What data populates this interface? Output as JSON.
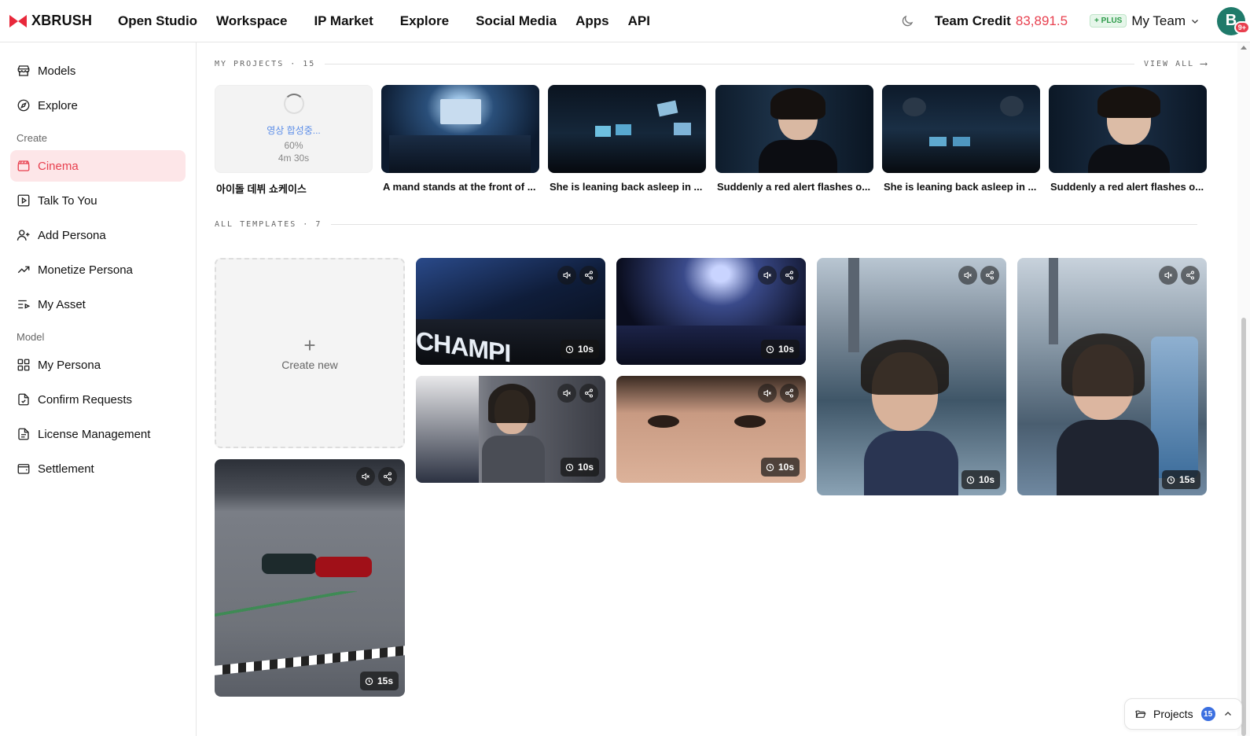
{
  "brand": {
    "name": "XBRUSH"
  },
  "nav": [
    {
      "label": "Open Studio"
    },
    {
      "label": "Workspace"
    },
    {
      "label": "IP Market"
    },
    {
      "label": "Explore"
    },
    {
      "label": "Social Media"
    },
    {
      "label": "Apps"
    },
    {
      "label": "API"
    }
  ],
  "header": {
    "credit_label": "Team Credit",
    "credit_value": "83,891.5",
    "plan_badge": "+ PLUS",
    "team_name": "My Team",
    "avatar_initial": "B",
    "notification_badge": "9+"
  },
  "sidebar": {
    "top_items": [
      {
        "label": "Models",
        "icon": "store-icon"
      },
      {
        "label": "Explore",
        "icon": "compass-icon"
      }
    ],
    "create_section": "Create",
    "create_items": [
      {
        "label": "Cinema",
        "icon": "clapperboard-icon",
        "active": true
      },
      {
        "label": "Talk To You",
        "icon": "play-square-icon"
      },
      {
        "label": "Add Persona",
        "icon": "user-plus-icon"
      },
      {
        "label": "Monetize Persona",
        "icon": "trending-up-icon"
      },
      {
        "label": "My Asset",
        "icon": "list-video-icon"
      }
    ],
    "model_section": "Model",
    "model_items": [
      {
        "label": "My Persona",
        "icon": "layout-grid-icon"
      },
      {
        "label": "Confirm Requests",
        "icon": "file-check-icon"
      },
      {
        "label": "License Management",
        "icon": "file-text-icon"
      },
      {
        "label": "Settlement",
        "icon": "wallet-icon"
      }
    ]
  },
  "projects": {
    "heading": "MY PROJECTS · 15",
    "view_all": "VIEW ALL",
    "items": [
      {
        "title": "아이돌 데뷔 쇼케이스",
        "status": "영상 합성중...",
        "progress": "60%",
        "remaining": "4m 30s"
      },
      {
        "title": "A mand stands at the front of ..."
      },
      {
        "title": "She is leaning back asleep in ..."
      },
      {
        "title": "Suddenly a red alert flashes o..."
      },
      {
        "title": "She is leaning back asleep in ..."
      },
      {
        "title": "Suddenly a red alert flashes o..."
      }
    ]
  },
  "templates": {
    "heading": "ALL TEMPLATES · 7",
    "create_label": "Create new",
    "items": [
      {
        "duration": "10s"
      },
      {
        "duration": "10s"
      },
      {
        "duration": "10s"
      },
      {
        "duration": "10s"
      },
      {
        "duration": "15s"
      },
      {
        "duration": "10s"
      },
      {
        "duration": "15s"
      }
    ]
  },
  "projects_pill": {
    "label": "Projects",
    "count": "15"
  },
  "colors": {
    "accent": "#e8404f",
    "active_bg": "#fde6e8",
    "link_blue": "#5b8de8",
    "count_blue": "#3b6fe0"
  }
}
